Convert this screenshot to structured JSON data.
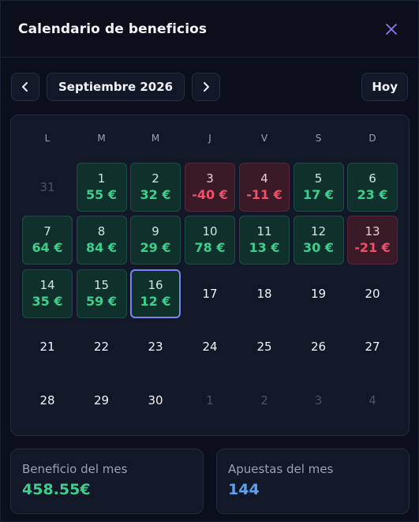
{
  "header": {
    "title": "Calendario de beneficios",
    "close_icon": "close-icon"
  },
  "toolbar": {
    "prev_icon": "chevron-left-icon",
    "next_icon": "chevron-right-icon",
    "month_label": "Septiembre 2026",
    "today_label": "Hoy"
  },
  "calendar": {
    "weekdays": [
      "L",
      "M",
      "M",
      "J",
      "V",
      "S",
      "D"
    ],
    "days": [
      {
        "num": "31",
        "amount": "",
        "type": "muted"
      },
      {
        "num": "1",
        "amount": "55 €",
        "type": "pos"
      },
      {
        "num": "2",
        "amount": "32 €",
        "type": "pos"
      },
      {
        "num": "3",
        "amount": "-40 €",
        "type": "neg"
      },
      {
        "num": "4",
        "amount": "-11 €",
        "type": "neg"
      },
      {
        "num": "5",
        "amount": "17 €",
        "type": "pos"
      },
      {
        "num": "6",
        "amount": "23 €",
        "type": "pos"
      },
      {
        "num": "7",
        "amount": "64 €",
        "type": "pos"
      },
      {
        "num": "8",
        "amount": "84 €",
        "type": "pos"
      },
      {
        "num": "9",
        "amount": "29 €",
        "type": "pos"
      },
      {
        "num": "10",
        "amount": "78 €",
        "type": "pos"
      },
      {
        "num": "11",
        "amount": "13 €",
        "type": "pos"
      },
      {
        "num": "12",
        "amount": "30 €",
        "type": "pos"
      },
      {
        "num": "13",
        "amount": "-21 €",
        "type": "neg"
      },
      {
        "num": "14",
        "amount": "35 €",
        "type": "pos"
      },
      {
        "num": "15",
        "amount": "59 €",
        "type": "pos"
      },
      {
        "num": "16",
        "amount": "12 €",
        "type": "pos",
        "today": true
      },
      {
        "num": "17",
        "amount": "",
        "type": "plain"
      },
      {
        "num": "18",
        "amount": "",
        "type": "plain"
      },
      {
        "num": "19",
        "amount": "",
        "type": "plain"
      },
      {
        "num": "20",
        "amount": "",
        "type": "plain"
      },
      {
        "num": "21",
        "amount": "",
        "type": "plain"
      },
      {
        "num": "22",
        "amount": "",
        "type": "plain"
      },
      {
        "num": "23",
        "amount": "",
        "type": "plain"
      },
      {
        "num": "24",
        "amount": "",
        "type": "plain"
      },
      {
        "num": "25",
        "amount": "",
        "type": "plain"
      },
      {
        "num": "26",
        "amount": "",
        "type": "plain"
      },
      {
        "num": "27",
        "amount": "",
        "type": "plain"
      },
      {
        "num": "28",
        "amount": "",
        "type": "plain"
      },
      {
        "num": "29",
        "amount": "",
        "type": "plain"
      },
      {
        "num": "30",
        "amount": "",
        "type": "plain"
      },
      {
        "num": "1",
        "amount": "",
        "type": "muted"
      },
      {
        "num": "2",
        "amount": "",
        "type": "muted"
      },
      {
        "num": "3",
        "amount": "",
        "type": "muted"
      },
      {
        "num": "4",
        "amount": "",
        "type": "muted"
      }
    ]
  },
  "stats": {
    "profit_label": "Beneficio del mes",
    "profit_value": "458.55€",
    "bets_label": "Apuestas del mes",
    "bets_value": "144"
  },
  "colors": {
    "positive": "#3ecf8e",
    "negative": "#f0506e",
    "accent": "#7b83f5",
    "bets_value": "#5aa2f5"
  }
}
